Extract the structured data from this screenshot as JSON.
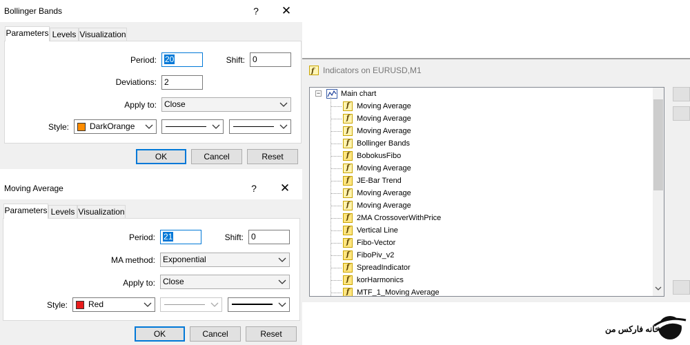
{
  "bollinger": {
    "title": "Bollinger Bands",
    "help": "?",
    "close": "✕",
    "tabs": [
      "Parameters",
      "Levels",
      "Visualization"
    ],
    "period_label": "Period:",
    "period": "20",
    "shift_label": "Shift:",
    "shift": "0",
    "deviations_label": "Deviations:",
    "deviations": "2",
    "apply_label": "Apply to:",
    "apply": "Close",
    "style_label": "Style:",
    "color_name": "DarkOrange",
    "color_hex": "#ff8c00",
    "ok": "OK",
    "cancel": "Cancel",
    "reset": "Reset"
  },
  "moving_average": {
    "title": "Moving Average",
    "help": "?",
    "close": "✕",
    "tabs": [
      "Parameters",
      "Levels",
      "Visualization"
    ],
    "period_label": "Period:",
    "period": "21",
    "shift_label": "Shift:",
    "shift": "0",
    "method_label": "MA method:",
    "method": "Exponential",
    "apply_label": "Apply to:",
    "apply": "Close",
    "style_label": "Style:",
    "color_name": "Red",
    "color_hex": "#e81c1c",
    "ok": "OK",
    "cancel": "Cancel",
    "reset": "Reset"
  },
  "indicators": {
    "title": "Indicators on EURUSD,M1",
    "root": "Main chart",
    "items": [
      {
        "label": "Moving Average",
        "icon": "f"
      },
      {
        "label": "Moving Average",
        "icon": "f"
      },
      {
        "label": "Moving Average",
        "icon": "f"
      },
      {
        "label": "Bollinger Bands",
        "icon": "f"
      },
      {
        "label": "BobokusFibo",
        "icon": "fx"
      },
      {
        "label": "Moving Average",
        "icon": "f"
      },
      {
        "label": "JE-Bar Trend",
        "icon": "fx"
      },
      {
        "label": "Moving Average",
        "icon": "f"
      },
      {
        "label": "Moving Average",
        "icon": "f"
      },
      {
        "label": "2MA CrossoverWithPrice",
        "icon": "fx"
      },
      {
        "label": "Vertical Line",
        "icon": "fx"
      },
      {
        "label": "Fibo-Vector",
        "icon": "fx"
      },
      {
        "label": "FiboPiv_v2",
        "icon": "fx"
      },
      {
        "label": "SpreadIndicator",
        "icon": "fx"
      },
      {
        "label": "korHarmonics",
        "icon": "fx"
      },
      {
        "label": "MTF_1_Moving Average",
        "icon": "fx"
      }
    ]
  },
  "brand": "خانه فارکس من"
}
